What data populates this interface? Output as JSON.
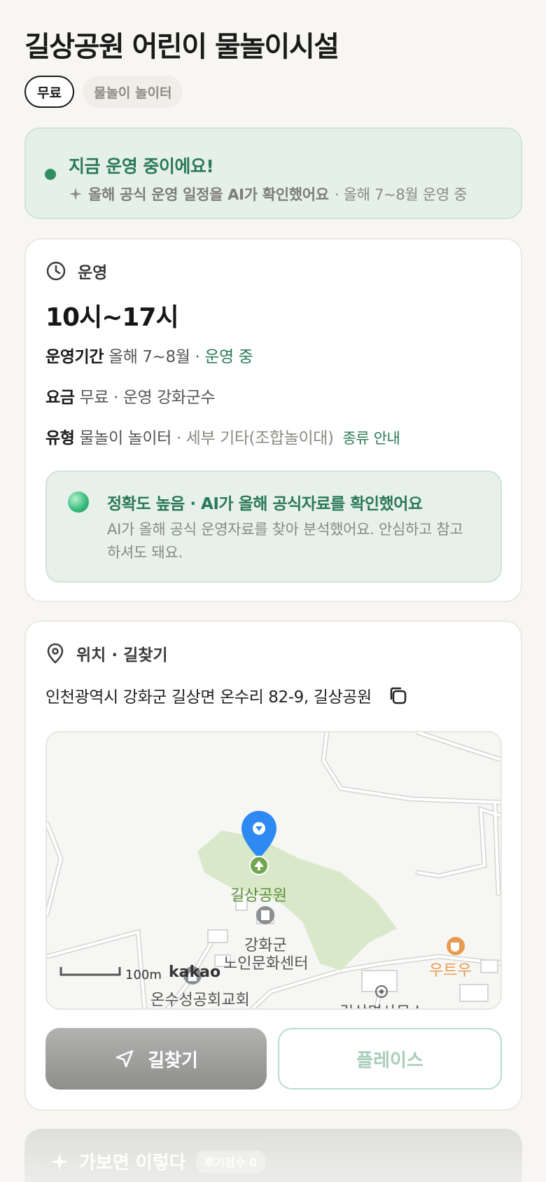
{
  "header": {
    "title": "길상공원 어린이 물놀이시설",
    "chips": [
      "무료",
      "물놀이 놀이터"
    ]
  },
  "status": {
    "headline": "지금 운영 중이에요!",
    "sub_strong": "올해 공식 운영 일정을 AI가 확인했어요",
    "sub_rest": "· 올해 7~8월 운영 중",
    "color": "#2a7a55"
  },
  "operation": {
    "section_label": "운영",
    "icon": "clock-icon",
    "hours": "10시~17시",
    "period_label": "운영기간",
    "period_value": "올해 7~8월",
    "period_status": "· 운영 중",
    "fee_label": "요금",
    "fee_value": "무료 · 운영 강화군수",
    "type_label": "유형",
    "type_value": "물놀이 놀이터",
    "type_detail": "· 세부 기타(조합놀이대)",
    "type_link": "종류 안내"
  },
  "ai_notice": {
    "title": "정확도 높음 · AI가 올해 공식자료를 확인했어요",
    "description": "AI가 올해 공식 운영자료를 찾아 분석했어요. 안심하고 참고하셔도 돼요."
  },
  "location": {
    "section_label": "위치 · 길찾기",
    "icon": "map-pin-icon",
    "address": "인천광역시 강화군 길상면 온수리 82-9, 길상공원",
    "map": {
      "poi_park": "길상공원",
      "poi_center_line1": "강화군",
      "poi_center_line2": "노인문화센터",
      "poi_cafe": "우트우",
      "poi_church": "온수성공회교회",
      "poi_office": "길상면사무소",
      "scale": "100m",
      "logo": "kakao"
    },
    "directions_label": "길찾기",
    "place_label": "플레이스"
  },
  "next_section": {
    "title": "가보면 이렇다",
    "badge": "후기접수 0"
  }
}
